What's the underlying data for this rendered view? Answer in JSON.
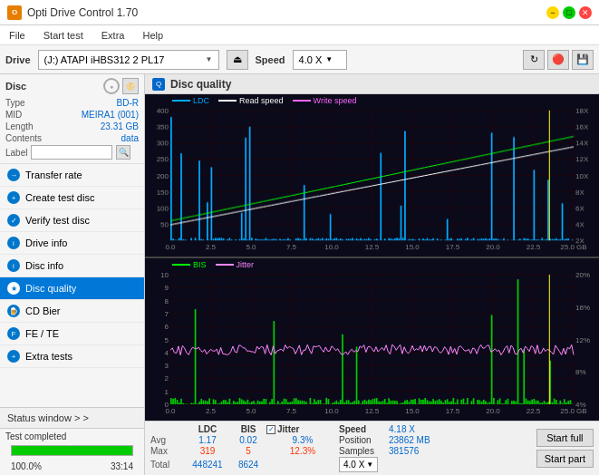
{
  "titlebar": {
    "title": "Opti Drive Control 1.70",
    "icon": "O",
    "btn_min": "−",
    "btn_max": "□",
    "btn_close": "✕"
  },
  "menubar": {
    "items": [
      "File",
      "Start test",
      "Extra",
      "Help"
    ]
  },
  "drivebar": {
    "label": "Drive",
    "drive_text": "(J:) ATAPI iHBS312  2 PL17",
    "speed_label": "Speed",
    "speed_value": "4.0 X",
    "eject_label": "⏏"
  },
  "disc": {
    "label": "Disc",
    "type_key": "Type",
    "type_val": "BD-R",
    "mid_key": "MID",
    "mid_val": "MEIRA1 (001)",
    "length_key": "Length",
    "length_val": "23.31 GB",
    "contents_key": "Contents",
    "contents_val": "data",
    "label_key": "Label",
    "label_val": ""
  },
  "sidebar": {
    "items": [
      {
        "id": "transfer-rate",
        "label": "Transfer rate",
        "active": false
      },
      {
        "id": "create-test-disc",
        "label": "Create test disc",
        "active": false
      },
      {
        "id": "verify-test-disc",
        "label": "Verify test disc",
        "active": false
      },
      {
        "id": "drive-info",
        "label": "Drive info",
        "active": false
      },
      {
        "id": "disc-info",
        "label": "Disc info",
        "active": false
      },
      {
        "id": "disc-quality",
        "label": "Disc quality",
        "active": true
      },
      {
        "id": "cd-bier",
        "label": "CD Bier",
        "active": false
      },
      {
        "id": "fe-te",
        "label": "FE / TE",
        "active": false
      },
      {
        "id": "extra-tests",
        "label": "Extra tests",
        "active": false
      }
    ]
  },
  "chart": {
    "title": "Disc quality",
    "top_legend": [
      {
        "label": "LDC",
        "color": "#00aaff"
      },
      {
        "label": "Read speed",
        "color": "#ffffff"
      },
      {
        "label": "Write speed",
        "color": "#ff66ff"
      }
    ],
    "bottom_legend": [
      {
        "label": "BIS",
        "color": "#00ff00"
      },
      {
        "label": "Jitter",
        "color": "#ff88ff"
      }
    ],
    "top_y_left_max": "400",
    "top_y_left_ticks": [
      "400",
      "350",
      "300",
      "250",
      "200",
      "150",
      "100",
      "50"
    ],
    "top_y_right_ticks": [
      "18X",
      "16X",
      "14X",
      "12X",
      "10X",
      "8X",
      "6X",
      "4X",
      "2X"
    ],
    "bottom_y_left_max": "10",
    "bottom_y_right_ticks": [
      "20%",
      "16%",
      "12%",
      "8%",
      "4%"
    ],
    "x_ticks": [
      "0.0",
      "2.5",
      "5.0",
      "7.5",
      "10.0",
      "12.5",
      "15.0",
      "17.5",
      "20.0",
      "22.5",
      "25.0 GB"
    ]
  },
  "stats": {
    "headers": {
      "ldc": "LDC",
      "bis": "BIS",
      "jitter_label": "Jitter",
      "speed_label": "Speed",
      "position_label": "Position",
      "samples_label": "Samples"
    },
    "avg_label": "Avg",
    "max_label": "Max",
    "total_label": "Total",
    "avg_ldc": "1.17",
    "avg_bis": "0.02",
    "avg_jitter": "9.3%",
    "max_ldc": "319",
    "max_bis": "5",
    "max_jitter": "12.3%",
    "total_ldc": "448241",
    "total_bis": "8624",
    "speed_val": "4.18 X",
    "speed_dropdown": "4.0 X",
    "position_val": "23862 MB",
    "samples_val": "381576",
    "start_full": "Start full",
    "start_part": "Start part"
  },
  "statusbar": {
    "status_window_label": "Status window > >",
    "status_text": "Test completed",
    "progress": 100,
    "time": "33:14"
  }
}
